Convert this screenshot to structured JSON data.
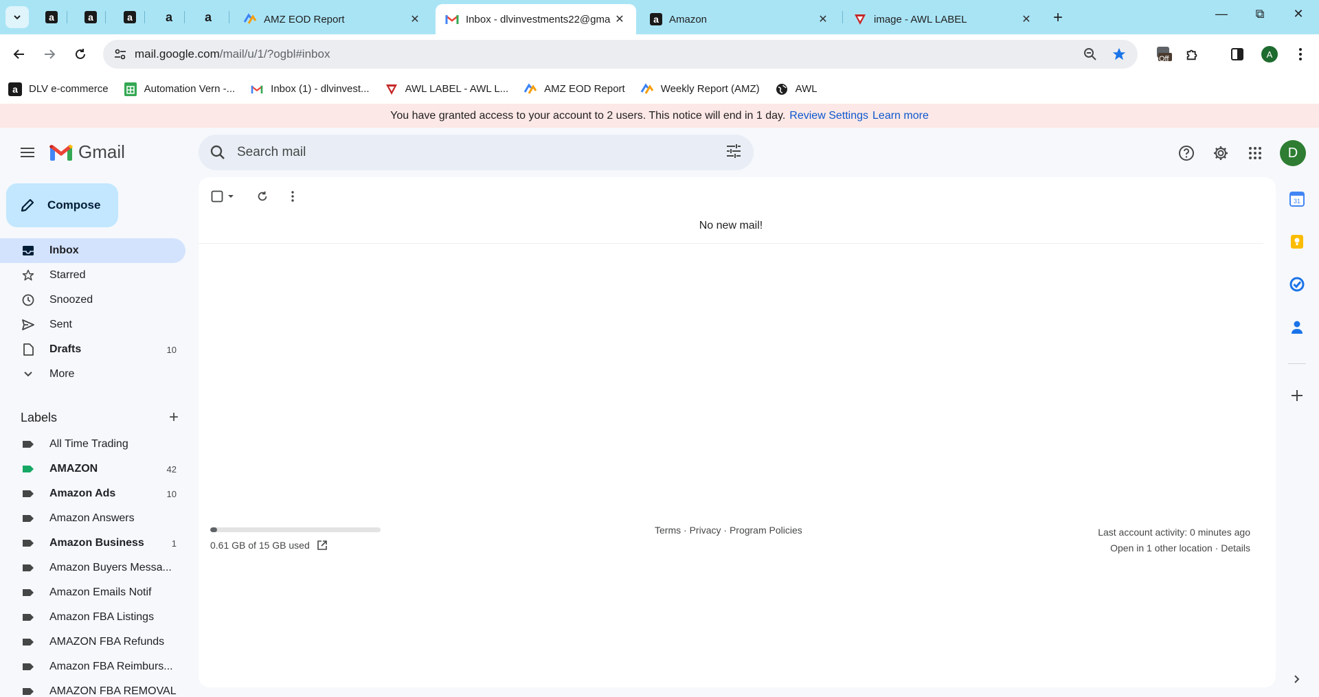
{
  "browser": {
    "pinned_tabs": [
      "a",
      "a",
      "a",
      "a",
      "a"
    ],
    "tabs": [
      {
        "title": "AMZ EOD Report",
        "active": false
      },
      {
        "title": "Inbox - dlvinvestments22@gma",
        "active": true
      },
      {
        "title": "Amazon",
        "active": false
      },
      {
        "title": "image - AWL LABEL",
        "active": false
      }
    ],
    "new_tab": "+",
    "url": {
      "host": "mail.google.com",
      "path": "/mail/u/1/?ogbl#inbox"
    },
    "extension_badge": "Off",
    "profile_letter": "A"
  },
  "bookmarks": [
    {
      "label": "DLV e-commerce",
      "icon": "amazon-icon"
    },
    {
      "label": "Automation Vern -...",
      "icon": "sheets-icon"
    },
    {
      "label": "Inbox (1) - dlvinvest...",
      "icon": "gmail-icon"
    },
    {
      "label": "AWL LABEL - AWL L...",
      "icon": "awl-icon"
    },
    {
      "label": "AMZ EOD Report",
      "icon": "report-icon"
    },
    {
      "label": "Weekly Report (AMZ)",
      "icon": "report-icon"
    },
    {
      "label": "AWL",
      "icon": "globe-icon"
    }
  ],
  "notice": {
    "text": "You have granted access to your account to 2 users. This notice will end in 1 day.",
    "link1": "Review Settings",
    "link2": "Learn more"
  },
  "gmail": {
    "brand": "Gmail",
    "search_placeholder": "Search mail",
    "avatar_letter": "D",
    "compose_label": "Compose",
    "nav": [
      {
        "label": "Inbox",
        "count": "",
        "icon": "inbox-icon",
        "active": true
      },
      {
        "label": "Starred",
        "count": "",
        "icon": "star-icon"
      },
      {
        "label": "Snoozed",
        "count": "",
        "icon": "clock-icon"
      },
      {
        "label": "Sent",
        "count": "",
        "icon": "send-icon"
      },
      {
        "label": "Drafts",
        "count": "10",
        "icon": "draft-icon",
        "bold": true
      },
      {
        "label": "More",
        "count": "",
        "icon": "chevron-down-icon"
      }
    ],
    "labels_title": "Labels",
    "labels": [
      {
        "label": "All Time Trading",
        "count": "",
        "color": "#444746"
      },
      {
        "label": "AMAZON",
        "count": "42",
        "color": "#16a765",
        "bold": true
      },
      {
        "label": "Amazon Ads",
        "count": "10",
        "color": "#444746",
        "bold": true
      },
      {
        "label": "Amazon Answers",
        "count": "",
        "color": "#444746"
      },
      {
        "label": "Amazon Business",
        "count": "1",
        "color": "#444746",
        "bold": true
      },
      {
        "label": "Amazon Buyers Messa...",
        "count": "",
        "color": "#444746"
      },
      {
        "label": "Amazon Emails Notif",
        "count": "",
        "color": "#444746"
      },
      {
        "label": "Amazon FBA Listings",
        "count": "",
        "color": "#444746"
      },
      {
        "label": "AMAZON FBA Refunds",
        "count": "",
        "color": "#444746"
      },
      {
        "label": "Amazon FBA Reimburs...",
        "count": "",
        "color": "#444746"
      },
      {
        "label": "AMAZON FBA REMOVAL",
        "count": "",
        "color": "#444746"
      }
    ],
    "empty_message": "No new mail!",
    "storage": {
      "text": "0.61 GB of 15 GB used",
      "used_fraction": 0.04
    },
    "footer": {
      "terms": "Terms",
      "privacy": "Privacy",
      "policies": "Program Policies",
      "sep": " · "
    },
    "activity": {
      "line1": "Last account activity: 0 minutes ago",
      "line2": "Open in 1 other location · Details"
    }
  }
}
